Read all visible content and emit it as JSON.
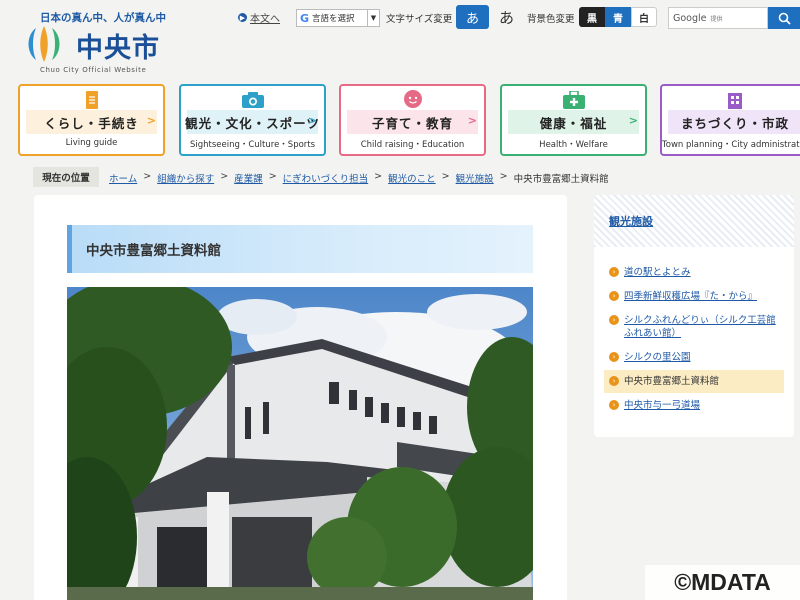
{
  "header": {
    "tagline": "日本の真ん中、人が真ん中",
    "logo_text": "中央市",
    "logo_sub": "Chuo City Official Website",
    "honbun_link": "本文へ",
    "lang_select": "言語を選択",
    "font_size_label": "文字サイズ変更",
    "font_size_buttons": [
      "あ",
      "あ"
    ],
    "bg_color_label": "背景色変更",
    "bg_color_buttons": [
      "黒",
      "青",
      "白"
    ],
    "search_brand": "Google",
    "search_brand_sub": "提供"
  },
  "nav": [
    {
      "label": "くらし・手続き",
      "sub": "Living guide",
      "color": "#f0a12a",
      "icon": "document-icon"
    },
    {
      "label": "観光・文化・スポーツ",
      "sub": "Sightseeing・Culture・Sports",
      "color": "#2ca0c8",
      "icon": "camera-icon"
    },
    {
      "label": "子育て・教育",
      "sub": "Child raising・Education",
      "color": "#e46a86",
      "icon": "child-face-icon"
    },
    {
      "label": "健康・福祉",
      "sub": "Health・Welfare",
      "color": "#3ab073",
      "icon": "medical-bag-icon"
    },
    {
      "label": "まちづくり・市政",
      "sub": "Town planning・City administration",
      "color": "#9a5bc8",
      "icon": "building-icon"
    }
  ],
  "breadcrumb": {
    "label": "現在の位置",
    "items": [
      "ホーム",
      "組織から探す",
      "産業課",
      "にぎわいづくり担当",
      "観光のこと",
      "観光施設"
    ],
    "current": "中央市豊富郷土資料館"
  },
  "main": {
    "title": "中央市豊富郷土資料館"
  },
  "side": {
    "title": "観光施設",
    "items": [
      "道の駅とよとみ",
      "四季新鮮収穫広場『た・から』",
      "シルクふれんどりぃ（シルク工芸館ふれあい館）",
      "シルクの里公園",
      "中央市豊富郷土資料館",
      "中央市与一弓道場"
    ],
    "active_index": 4
  },
  "watermark": "©MDATA"
}
